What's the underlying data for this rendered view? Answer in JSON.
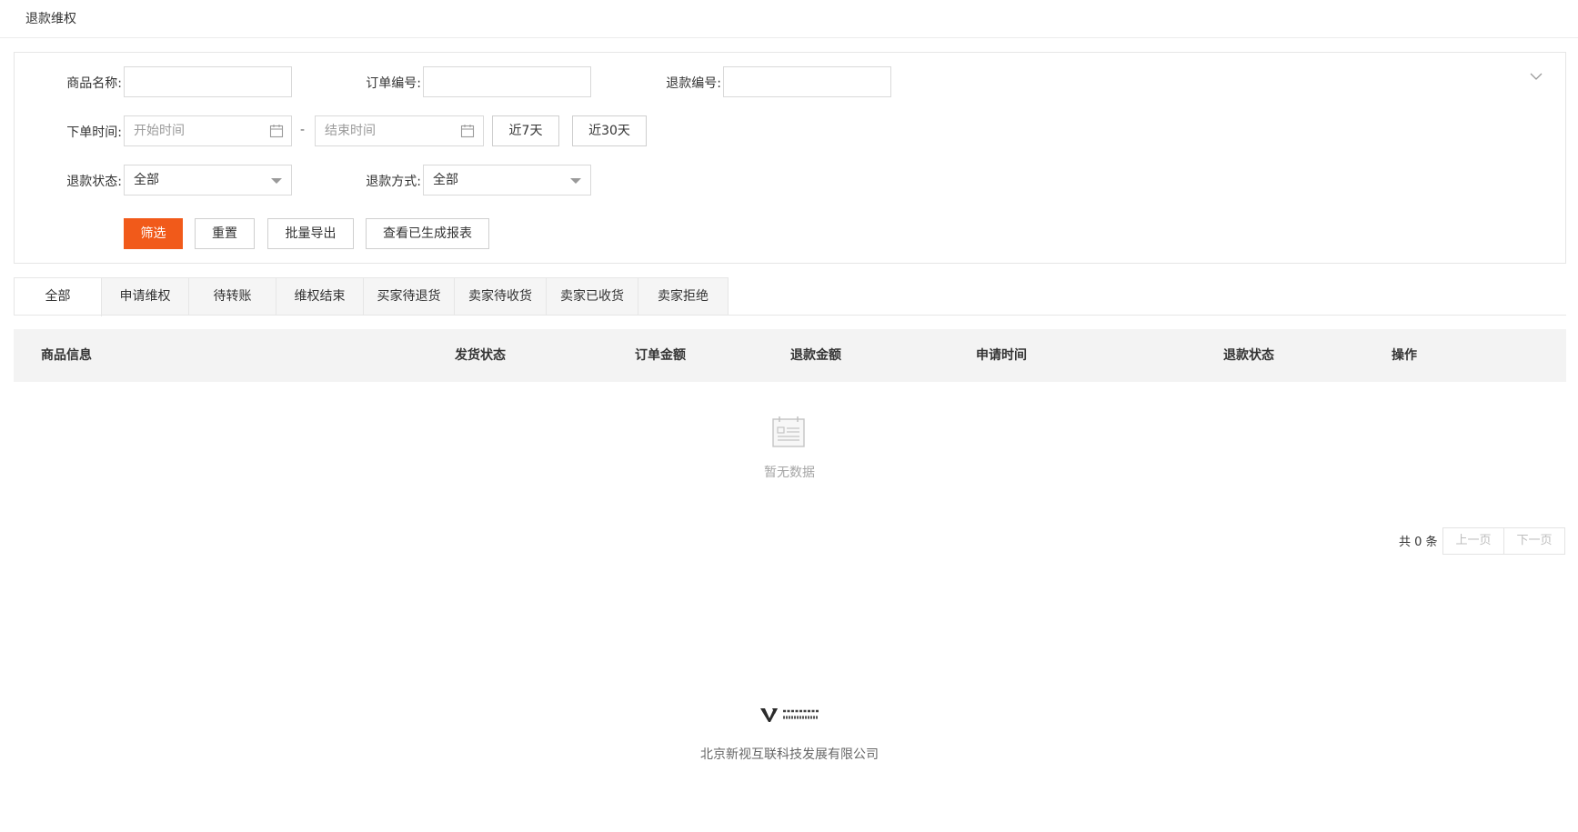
{
  "header": {
    "title": "退款维权"
  },
  "filters": {
    "product_name": {
      "label": "商品名称:",
      "value": "",
      "placeholder": ""
    },
    "order_no": {
      "label": "订单编号:",
      "value": "",
      "placeholder": ""
    },
    "refund_no": {
      "label": "退款编号:",
      "value": "",
      "placeholder": ""
    },
    "order_time": {
      "label": "下单时间:",
      "start_placeholder": "开始时间",
      "separator": "-",
      "end_placeholder": "结束时间",
      "quick_7": "近7天",
      "quick_30": "近30天"
    },
    "refund_status": {
      "label": "退款状态:",
      "selected": "全部"
    },
    "refund_method": {
      "label": "退款方式:",
      "selected": "全部"
    },
    "actions": {
      "filter": "筛选",
      "reset": "重置",
      "export": "批量导出",
      "view_reports": "查看已生成报表"
    }
  },
  "tabs": [
    {
      "label": "全部",
      "active": true
    },
    {
      "label": "申请维权",
      "active": false
    },
    {
      "label": "待转账",
      "active": false
    },
    {
      "label": "维权结束",
      "active": false
    },
    {
      "label": "买家待退货",
      "active": false
    },
    {
      "label": "卖家待收货",
      "active": false
    },
    {
      "label": "卖家已收货",
      "active": false
    },
    {
      "label": "卖家拒绝",
      "active": false
    }
  ],
  "table": {
    "columns": [
      "商品信息",
      "发货状态",
      "订单金额",
      "退款金额",
      "申请时间",
      "退款状态",
      "操作"
    ],
    "rows": [],
    "empty_text": "暂无数据"
  },
  "pagination": {
    "total_text": "共 0 条",
    "prev": "上一页",
    "next": "下一页"
  },
  "footer": {
    "company": "北京新视互联科技发展有限公司"
  },
  "colors": {
    "primary": "#f15a1a",
    "header_bg": "#f3f3f3",
    "tab_bg": "#f5f5f5"
  },
  "icons": [
    "chevron-down-icon",
    "calendar-icon",
    "empty-data-icon",
    "company-logo"
  ]
}
